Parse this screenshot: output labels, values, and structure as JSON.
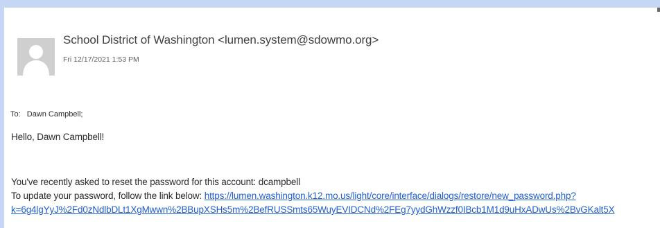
{
  "email": {
    "sender": "School District of Washington <lumen.system@sdowmo.org>",
    "sent": "Fri 12/17/2021 1:53 PM",
    "to_label": "To:",
    "to_value": "Dawn Campbell;",
    "greeting": "Hello, Dawn Campbell!",
    "body_line_1": "You've recently asked to reset the password for this account: dcampbell",
    "body_line_2_prefix": "To update your password, follow the link below: ",
    "link_line_1": "https://lumen.washington.k12.mo.us/light/core/interface/dialogs/restore/new_password.php?",
    "link_line_2": "k=6g4lgYyJ%2Fd0zNdlbDLt1XgMwwn%2BBupXSHs5m%2BefRUSSmts65WuyEVIDCNd%2FEg7yydGhWzzf0IBcb1M1d9uHxADwUs%2BvGKalt5X"
  },
  "colors": {
    "background": "#c6d7f5",
    "link": "#1f5ed6",
    "avatar": "#cfcfcf"
  },
  "icons": {
    "avatar": "person-silhouette-icon"
  }
}
